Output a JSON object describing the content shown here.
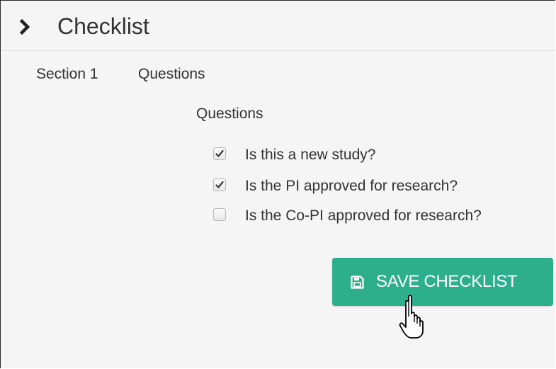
{
  "panel": {
    "title": "Checklist",
    "expand_icon": "chevron-right-icon"
  },
  "section": {
    "label": "Section 1",
    "name": "Questions",
    "questions_heading": "Questions",
    "questions": [
      {
        "text": "Is this a new study?",
        "checked": true
      },
      {
        "text": "Is the PI approved for research?",
        "checked": true
      },
      {
        "text": "Is the Co-PI approved for research?",
        "checked": false
      }
    ]
  },
  "actions": {
    "save_label": "SAVE CHECKLIST",
    "save_icon": "floppy-disk-icon"
  },
  "cursor": {
    "icon": "hand-pointer-icon"
  },
  "colors": {
    "accent": "#2eaf8c",
    "background": "#f5f5f5",
    "text": "#333333"
  }
}
